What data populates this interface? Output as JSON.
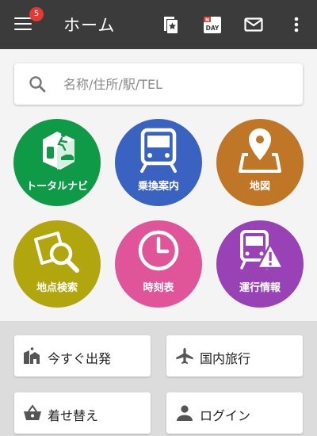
{
  "appbar": {
    "badge_count": "5",
    "title": "ホーム",
    "icons": [
      "menu-icon",
      "bookmark-star-icon",
      "nday-calendar-icon",
      "mail-icon",
      "more-vert-icon"
    ],
    "nday_text": "DAY",
    "nday_prefix": "N"
  },
  "search": {
    "placeholder": "名称/住所/駅/TEL"
  },
  "tiles": [
    {
      "label": "トータルナビ",
      "color": "#0f9a48",
      "icon": "total-navi-icon"
    },
    {
      "label": "乗換案内",
      "color": "#3a62c0",
      "icon": "train-icon"
    },
    {
      "label": "地図",
      "color": "#bf7627",
      "icon": "map-pin-icon"
    },
    {
      "label": "地点検索",
      "color": "#b1a60d",
      "icon": "location-search-icon"
    },
    {
      "label": "時刻表",
      "color": "#e0559a",
      "icon": "clock-icon"
    },
    {
      "label": "運行情報",
      "color": "#9842b5",
      "icon": "train-warning-icon"
    }
  ],
  "cards": [
    {
      "label": "今すぐ出発",
      "icon": "depart-icon"
    },
    {
      "label": "国内旅行",
      "icon": "airplane-icon"
    },
    {
      "label": "着せ替え",
      "icon": "basket-icon"
    },
    {
      "label": "ログイン",
      "icon": "person-icon"
    }
  ]
}
